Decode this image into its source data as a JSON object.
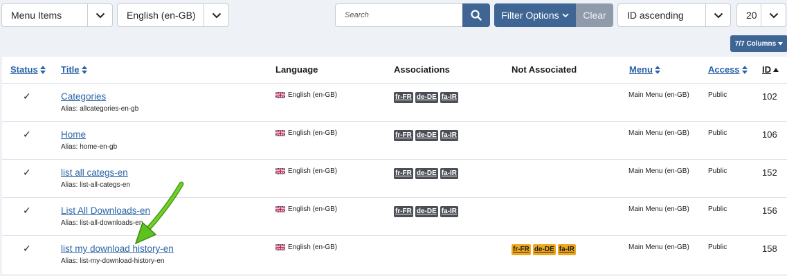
{
  "toolbar": {
    "menu_select": "Menu Items",
    "language_select": "English (en-GB)",
    "search_placeholder": "Search",
    "filter_options": "Filter Options",
    "clear": "Clear",
    "ordering_select": "ID ascending",
    "limit_select": "20",
    "columns_button": "7/7 Columns"
  },
  "table": {
    "headers": {
      "status": "Status",
      "title": "Title",
      "language": "Language",
      "associations": "Associations",
      "not_associated": "Not Associated",
      "menu": "Menu",
      "access": "Access",
      "id": "ID"
    },
    "rows": [
      {
        "check": "✓",
        "title": "Categories",
        "alias": "Alias: allcategories-en-gb",
        "language": "English (en-GB)",
        "associations": [
          "fr-FR",
          "de-DE",
          "fa-IR"
        ],
        "not_associated": [],
        "menu": "Main Menu (en-GB)",
        "access": "Public",
        "id": "102"
      },
      {
        "check": "✓",
        "title": "Home",
        "alias": "Alias: home-en-gb",
        "language": "English (en-GB)",
        "associations": [
          "fr-FR",
          "de-DE",
          "fa-IR"
        ],
        "not_associated": [],
        "menu": "Main Menu (en-GB)",
        "access": "Public",
        "id": "106"
      },
      {
        "check": "✓",
        "title": "list all categs-en",
        "alias": "Alias: list-all-categs-en",
        "language": "English (en-GB)",
        "associations": [
          "fr-FR",
          "de-DE",
          "fa-IR"
        ],
        "not_associated": [],
        "menu": "Main Menu (en-GB)",
        "access": "Public",
        "id": "152"
      },
      {
        "check": "✓",
        "title": "List All Downloads-en",
        "alias": "Alias: list-all-downloads-en",
        "language": "English (en-GB)",
        "associations": [
          "fr-FR",
          "de-DE",
          "fa-IR"
        ],
        "not_associated": [],
        "menu": "Main Menu (en-GB)",
        "access": "Public",
        "id": "156"
      },
      {
        "check": "✓",
        "title": "list my download history-en",
        "alias": "Alias: list-my-download-history-en",
        "language": "English (en-GB)",
        "associations": [],
        "not_associated": [
          "fr-FR",
          "de-DE",
          "fa-IR"
        ],
        "menu": "Main Menu (en-GB)",
        "access": "Public",
        "id": "158"
      }
    ]
  },
  "colors": {
    "primary": "#3e6594",
    "link": "#2b63a6",
    "badge_gray": "#4b4f55",
    "badge_orange": "#f0a81c",
    "annotation_arrow": "#5cc21d"
  },
  "icons": {
    "search": "search-icon",
    "chevron": "chevron-down-icon",
    "sort": "sort-icon",
    "check": "check-icon",
    "flag": "uk-flag-icon",
    "arrow": "annotation-arrow-icon"
  }
}
